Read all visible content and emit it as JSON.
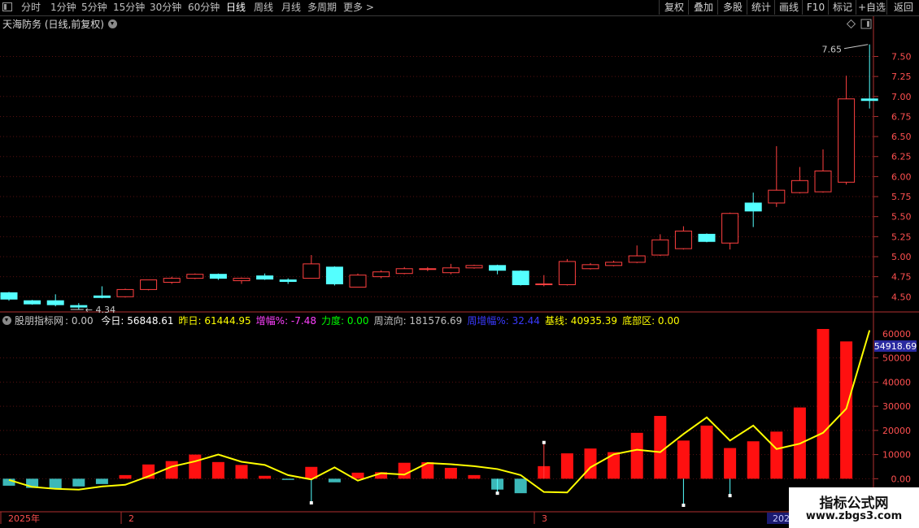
{
  "toolbar": {
    "left_items": [
      "分时",
      "1分钟",
      "5分钟",
      "15分钟",
      "30分钟",
      "60分钟",
      "日线",
      "周线",
      "月线",
      "多周期",
      "更多 >"
    ],
    "active_item": "日线",
    "right_buttons": [
      "复权",
      "叠加",
      "多股",
      "统计",
      "画线",
      "F10",
      "标记",
      "+自选",
      "返回"
    ]
  },
  "main_chart": {
    "title": "天海防务 (日线,前复权)",
    "up_color": "#ff4040",
    "down_color": "#54ffff",
    "y_ticks": [
      "7.50",
      "7.25",
      "7.00",
      "6.75",
      "6.50",
      "6.25",
      "6.00",
      "5.75",
      "5.50",
      "5.25",
      "5.00",
      "4.75",
      "4.50"
    ],
    "annotation_high": "7.65",
    "annotation_low": "4.34"
  },
  "indicator": {
    "name": "股朋指标网",
    "value": ": 0.00",
    "fields": [
      {
        "label": "今日:",
        "value": "56848.61",
        "color": "#ffffff"
      },
      {
        "label": "昨日:",
        "value": "61444.95",
        "color": "#ffff00"
      },
      {
        "label": "增幅%:",
        "value": "-7.48",
        "color": "#ff40ff"
      },
      {
        "label": "力度:",
        "value": "0.00",
        "color": "#00ff00"
      },
      {
        "label": "周流向:",
        "value": "181576.69",
        "color": "#c0c0c0"
      },
      {
        "label": "周增幅%:",
        "value": "32.44",
        "color": "#3a3aff"
      },
      {
        "label": "基线:",
        "value": "40935.39",
        "color": "#ffff00"
      },
      {
        "label": "底部区:",
        "value": "0.00",
        "color": "#ffff00"
      }
    ],
    "y_ticks": [
      "50000",
      "40000",
      "30000",
      "20000",
      "10000",
      "0.00"
    ],
    "current_value_box": "54918.69",
    "top_value": "60000"
  },
  "x_axis": {
    "labels": [
      {
        "text": "2025年"
      },
      {
        "text": "2"
      },
      {
        "text": "3"
      },
      {
        "text": "2025"
      }
    ]
  },
  "chart_data": {
    "type": "candlestick",
    "title": "天海防务 (日线,前复权)",
    "candles": [
      {
        "o": 4.55,
        "h": 4.56,
        "l": 4.45,
        "c": 4.47
      },
      {
        "o": 4.45,
        "h": 4.46,
        "l": 4.4,
        "c": 4.41
      },
      {
        "o": 4.45,
        "h": 4.53,
        "l": 4.38,
        "c": 4.4
      },
      {
        "o": 4.39,
        "h": 4.42,
        "l": 4.34,
        "c": 4.37
      },
      {
        "o": 4.51,
        "h": 4.63,
        "l": 4.48,
        "c": 4.49
      },
      {
        "o": 4.5,
        "h": 4.6,
        "l": 4.49,
        "c": 4.59
      },
      {
        "o": 4.59,
        "h": 4.71,
        "l": 4.58,
        "c": 4.71
      },
      {
        "o": 4.68,
        "h": 4.75,
        "l": 4.66,
        "c": 4.73
      },
      {
        "o": 4.73,
        "h": 4.79,
        "l": 4.72,
        "c": 4.78
      },
      {
        "o": 4.78,
        "h": 4.79,
        "l": 4.71,
        "c": 4.73
      },
      {
        "o": 4.7,
        "h": 4.74,
        "l": 4.66,
        "c": 4.73
      },
      {
        "o": 4.76,
        "h": 4.79,
        "l": 4.71,
        "c": 4.72
      },
      {
        "o": 4.71,
        "h": 4.73,
        "l": 4.66,
        "c": 4.69
      },
      {
        "o": 4.73,
        "h": 5.02,
        "l": 4.73,
        "c": 4.91
      },
      {
        "o": 4.87,
        "h": 4.88,
        "l": 4.64,
        "c": 4.66
      },
      {
        "o": 4.62,
        "h": 4.79,
        "l": 4.62,
        "c": 4.77
      },
      {
        "o": 4.75,
        "h": 4.83,
        "l": 4.73,
        "c": 4.81
      },
      {
        "o": 4.79,
        "h": 4.87,
        "l": 4.78,
        "c": 4.85
      },
      {
        "o": 4.84,
        "h": 4.87,
        "l": 4.82,
        "c": 4.85
      },
      {
        "o": 4.8,
        "h": 4.91,
        "l": 4.78,
        "c": 4.86
      },
      {
        "o": 4.86,
        "h": 4.9,
        "l": 4.85,
        "c": 4.89
      },
      {
        "o": 4.89,
        "h": 4.9,
        "l": 4.78,
        "c": 4.83
      },
      {
        "o": 4.82,
        "h": 4.83,
        "l": 4.64,
        "c": 4.65
      },
      {
        "o": 4.65,
        "h": 4.77,
        "l": 4.63,
        "c": 4.66
      },
      {
        "o": 4.65,
        "h": 4.97,
        "l": 4.64,
        "c": 4.94
      },
      {
        "o": 4.85,
        "h": 4.92,
        "l": 4.84,
        "c": 4.9
      },
      {
        "o": 4.89,
        "h": 4.95,
        "l": 4.88,
        "c": 4.93
      },
      {
        "o": 4.93,
        "h": 5.14,
        "l": 4.92,
        "c": 5.01
      },
      {
        "o": 5.02,
        "h": 5.28,
        "l": 5.01,
        "c": 5.21
      },
      {
        "o": 5.1,
        "h": 5.38,
        "l": 5.09,
        "c": 5.32
      },
      {
        "o": 5.28,
        "h": 5.29,
        "l": 5.18,
        "c": 5.19
      },
      {
        "o": 5.17,
        "h": 5.55,
        "l": 5.09,
        "c": 5.54
      },
      {
        "o": 5.67,
        "h": 5.8,
        "l": 5.37,
        "c": 5.57
      },
      {
        "o": 5.67,
        "h": 6.38,
        "l": 5.62,
        "c": 5.83
      },
      {
        "o": 5.8,
        "h": 6.12,
        "l": 5.79,
        "c": 5.95
      },
      {
        "o": 5.81,
        "h": 6.34,
        "l": 5.8,
        "c": 6.07
      },
      {
        "o": 5.93,
        "h": 7.26,
        "l": 5.9,
        "c": 6.97
      },
      {
        "o": 6.97,
        "h": 7.65,
        "l": 6.85,
        "c": 6.95
      }
    ],
    "indicator_bars": [
      -2900,
      -3800,
      -4200,
      -3200,
      -2200,
      1500,
      5900,
      7300,
      10000,
      6900,
      5700,
      1200,
      -500,
      4900,
      -1500,
      2500,
      2700,
      6600,
      6800,
      4500,
      1500,
      -4500,
      -6000,
      5200,
      10500,
      12500,
      11000,
      19000,
      26000,
      15800,
      22000,
      12700,
      15500,
      19500,
      29500,
      62000,
      56848.61
    ],
    "indicator_line": [
      -500,
      -3400,
      -4200,
      -4500,
      -3200,
      -2500,
      1000,
      5000,
      7200,
      10000,
      7000,
      5700,
      1500,
      -300,
      4700,
      -800,
      2300,
      1700,
      6500,
      6000,
      5200,
      4000,
      1500,
      -5500,
      -5700,
      4700,
      10100,
      12000,
      11000,
      18500,
      25400,
      15800,
      22000,
      12300,
      14500,
      19000,
      29000,
      61444.95
    ],
    "indicator_marks": [
      {
        "i": 13,
        "v": -10000
      },
      {
        "i": 21,
        "v": -6000
      },
      {
        "i": 23,
        "v": 15000
      },
      {
        "i": 29,
        "v": -11000
      },
      {
        "i": 31,
        "v": -7000
      }
    ],
    "price_ylim": [
      4.3,
      7.85
    ],
    "indicator_ylim": [
      -12000,
      62000
    ]
  }
}
